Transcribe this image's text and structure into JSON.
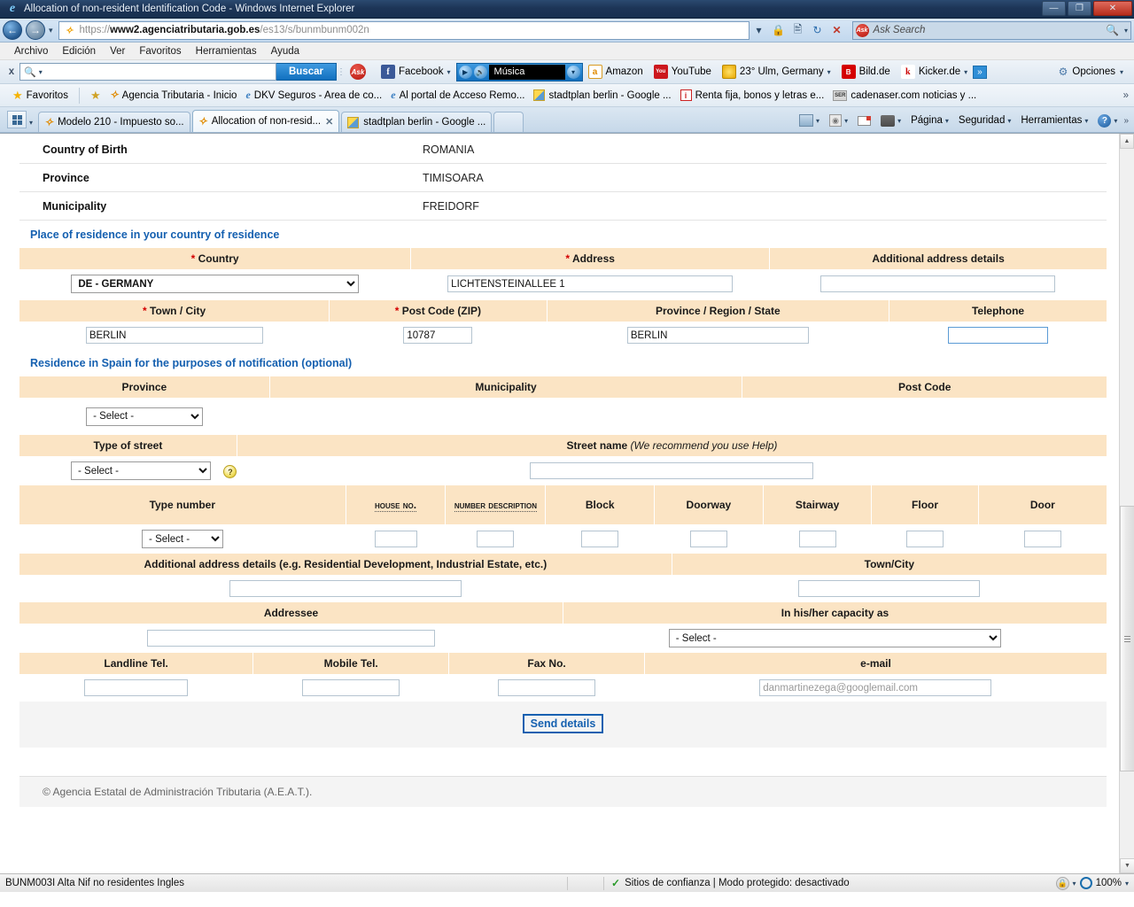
{
  "window": {
    "title": "Allocation of non-resident Identification Code - Windows Internet Explorer",
    "minimize": "—",
    "maximize": "❐",
    "close": "✕"
  },
  "address_bar": {
    "back_icon": "←",
    "forward_icon": "→",
    "url_scheme": "https",
    "url_sep": "://",
    "url_domain": "www2.agenciatributaria.gob.es",
    "url_path": "/es13/s/bunmbunm002n",
    "url_full": "https://www2.agenciatributaria.gob.es/es13/s/bunmbunm002n",
    "search_placeholder": "Ask Search",
    "search_brand": "Ask"
  },
  "menubar": {
    "items": [
      "Archivo",
      "Edición",
      "Ver",
      "Favoritos",
      "Herramientas",
      "Ayuda"
    ]
  },
  "ask_toolbar": {
    "close_label": "x",
    "search_value": "",
    "search_button": "Buscar",
    "brand": "Ask",
    "items": [
      {
        "label": "Facebook",
        "icon": "facebook-icon",
        "caret": true
      },
      {
        "label": "Música",
        "icon": "media-icon",
        "caret": false
      },
      {
        "label": "Amazon",
        "icon": "amazon-icon",
        "caret": false
      },
      {
        "label": "YouTube",
        "icon": "youtube-icon",
        "caret": false
      },
      {
        "label": "23° Ulm, Germany",
        "icon": "weather-icon",
        "caret": true
      },
      {
        "label": "Bild.de",
        "icon": "bild-icon",
        "caret": false
      },
      {
        "label": "Kicker.de",
        "icon": "kicker-icon",
        "caret": true
      }
    ],
    "overflow": "»",
    "options_label": "Opciones"
  },
  "favorites_bar": {
    "favorites_label": "Favoritos",
    "items": [
      {
        "label": "Agencia Tributaria - Inicio",
        "icon": "aeat-icon"
      },
      {
        "label": "DKV Seguros - Area de co...",
        "icon": "ie-icon"
      },
      {
        "label": "Al portal de Acceso Remo...",
        "icon": "ie-icon"
      },
      {
        "label": "stadtplan berlin - Google ...",
        "icon": "maps-pin-icon"
      },
      {
        "label": "Renta fija, bonos y letras e...",
        "icon": "info-icon"
      },
      {
        "label": "cadenaser.com noticias y ...",
        "icon": "ser-icon"
      }
    ],
    "overflow": "»"
  },
  "tabs": {
    "items": [
      {
        "label": "Modelo 210 - Impuesto so...",
        "active": false,
        "icon": "aeat-icon",
        "close": ""
      },
      {
        "label": "Allocation of non-resid...",
        "active": true,
        "icon": "aeat-icon",
        "close": "✕"
      },
      {
        "label": "stadtplan berlin - Google ...",
        "active": false,
        "icon": "maps-pin-icon",
        "close": ""
      }
    ],
    "new_tab": ""
  },
  "command_bar": {
    "items": [
      "Página",
      "Seguridad",
      "Herramientas"
    ],
    "overflow": "»",
    "caret": "▾"
  },
  "page": {
    "top_info": [
      {
        "label": "Country of Birth",
        "value": "ROMANIA"
      },
      {
        "label": "Province",
        "value": "TIMISOARA"
      },
      {
        "label": "Municipality",
        "value": "FREIDORF"
      }
    ],
    "section_residence_abroad": {
      "title": "Place of residence in your country of residence",
      "row1_headers": [
        {
          "required": "*",
          "label": "Country"
        },
        {
          "required": "*",
          "label": "Address"
        },
        {
          "required": "",
          "label": "Additional address details"
        }
      ],
      "country_value": "DE - GERMANY",
      "address_value": "LICHTENSTEINALLEE 1",
      "additional_value": "",
      "row2_headers": [
        {
          "required": "*",
          "label": "Town / City"
        },
        {
          "required": "*",
          "label": "Post Code (ZIP)"
        },
        {
          "required": "",
          "label": "Province / Region / State"
        },
        {
          "required": "",
          "label": "Telephone"
        }
      ],
      "town_value": "BERLIN",
      "postcode_value": "10787",
      "province_value": "BERLIN",
      "telephone_value": ""
    },
    "section_residence_spain": {
      "title": "Residence in Spain for the purposes of notification (optional)",
      "row1_headers": [
        "Province",
        "Municipality",
        "Post Code"
      ],
      "province_select": "- Select -",
      "row2_headers": [
        {
          "label": "Type of street",
          "note": ""
        },
        {
          "label": "Street name",
          "note": "(We recommend you use Help)"
        }
      ],
      "street_type_select": "- Select -",
      "help_icon_label": "?",
      "street_name_value": "",
      "row3_headers": [
        "Type number",
        "House No.",
        "Number description",
        "Block",
        "Doorway",
        "Stairway",
        "Floor",
        "Door"
      ],
      "type_number_select": "- Select -",
      "house_no_value": "",
      "number_description_value": "",
      "block_value": "",
      "doorway_value": "",
      "stairway_value": "",
      "floor_value": "",
      "door_value": "",
      "row4_headers": [
        "Additional address details (e.g. Residential Development, Industrial Estate, etc.)",
        "Town/City"
      ],
      "additional_details_value": "",
      "town_city_value": "",
      "row5_headers": [
        "Addressee",
        "In his/her capacity as"
      ],
      "addressee_value": "",
      "capacity_select": "- Select -",
      "row6_headers": [
        "Landline Tel.",
        "Mobile Tel.",
        "Fax No.",
        "e-mail"
      ],
      "landline_value": "",
      "mobile_value": "",
      "fax_value": "",
      "email_value": "danmartinezega@googlemail.com"
    },
    "send_button": "Send details",
    "footer": "© Agencia Estatal de Administración Tributaria (A.E.A.T.)."
  },
  "status_bar": {
    "message": "BUNM003I Alta Nif no residentes Ingles",
    "zone": "Sitios de confianza | Modo protegido: desactivado",
    "zoom": "100%",
    "check_icon": "✓"
  },
  "colors": {
    "header_bg": "#fbe4c4",
    "link_blue": "#1560b0",
    "required_red": "#d40000",
    "accent": "#1170bf"
  }
}
